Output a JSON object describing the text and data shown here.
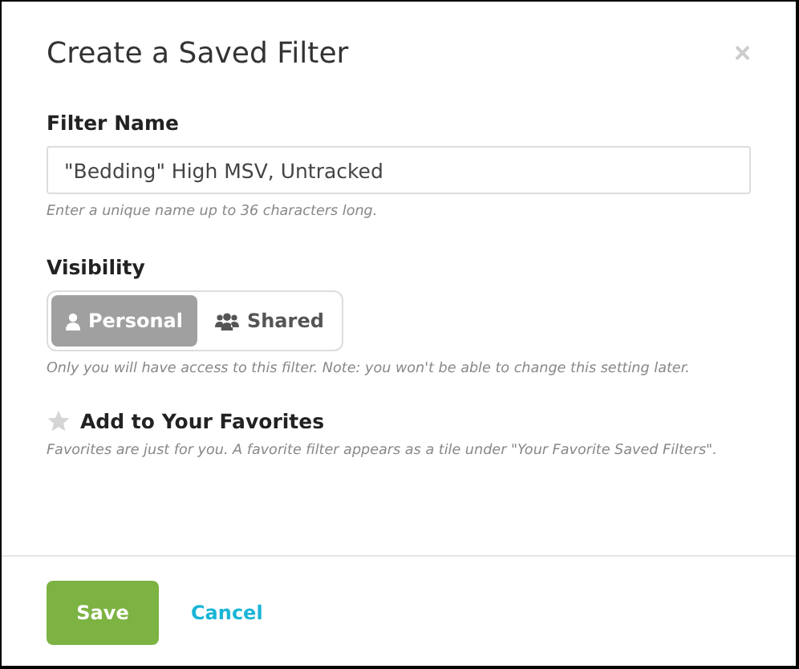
{
  "dialog": {
    "title": "Create a Saved Filter",
    "close": "×"
  },
  "filter_name": {
    "label": "Filter Name",
    "value": "\"Bedding\" High MSV, Untracked",
    "hint": "Enter a unique name up to 36 characters long."
  },
  "visibility": {
    "label": "Visibility",
    "options": [
      {
        "label": "Personal",
        "kind": "person",
        "selected": true
      },
      {
        "label": "Shared",
        "kind": "group",
        "selected": false
      }
    ],
    "hint": "Only you will have access to this filter. Note: you won't be able to change this setting later."
  },
  "favorite": {
    "label": "Add to Your Favorites",
    "checked": false,
    "hint": "Favorites are just for you. A favorite filter appears as a tile under \"Your Favorite Saved Filters\"."
  },
  "buttons": {
    "save": "Save",
    "cancel": "Cancel"
  }
}
